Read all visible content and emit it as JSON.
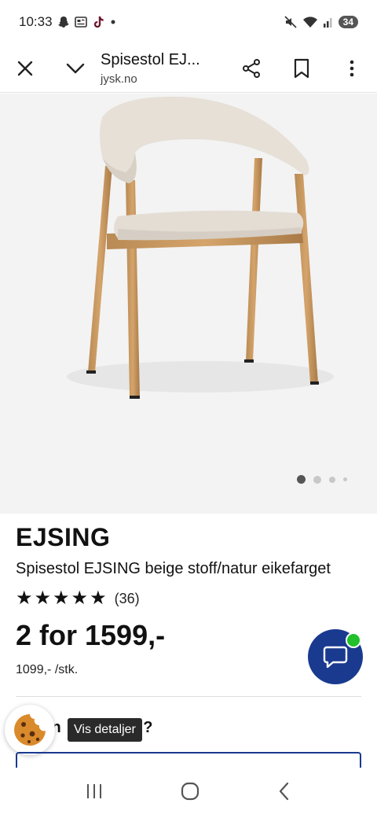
{
  "status_bar": {
    "time": "10:33",
    "battery": "34",
    "left_icons": [
      "snapchat-icon",
      "news-icon",
      "tiktok-icon",
      "dot-icon"
    ],
    "right_icons": [
      "mute-icon",
      "wifi-icon",
      "signal-icon",
      "battery-icon"
    ]
  },
  "browser": {
    "title": "Spisestol EJ...",
    "url": "jysk.no",
    "icons": [
      "close-icon",
      "chevron-down-icon",
      "share-icon",
      "bookmark-icon",
      "more-icon"
    ]
  },
  "gallery": {
    "image": "chair-image",
    "total_images": 4,
    "active_index": 0
  },
  "product": {
    "brand": "EJSING",
    "description": "Spisestol EJSING beige stoff/natur eikefarget",
    "rating": 4.5,
    "review_count": "(36)",
    "price": "2 for 1599,-",
    "unit_price": "1099,- /stk."
  },
  "question": "in          nting?",
  "tooltip": "Vis detaljer",
  "colors": {
    "accent": "#1a3a8f",
    "online": "#22c02a",
    "image_bg": "#f3f3f3"
  }
}
